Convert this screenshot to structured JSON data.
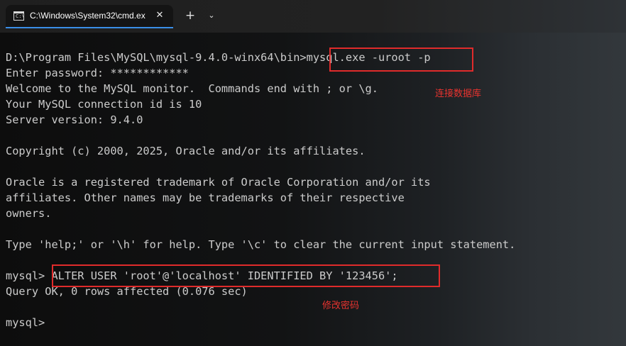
{
  "tab": {
    "icon": "cmd-icon",
    "title": "C:\\Windows\\System32\\cmd.ex",
    "close": "✕"
  },
  "titlebar": {
    "new_tab": "+",
    "dropdown": "⌄"
  },
  "terminal": {
    "lines": [
      "D:\\Program Files\\MySQL\\mysql-9.4.0-winx64\\bin>mysql.exe -uroot -p",
      "Enter password: ************",
      "Welcome to the MySQL monitor.  Commands end with ; or \\g.",
      "Your MySQL connection id is 10",
      "Server version: 9.4.0",
      "",
      "Copyright (c) 2000, 2025, Oracle and/or its affiliates.",
      "",
      "Oracle is a registered trademark of Oracle Corporation and/or its",
      "affiliates. Other names may be trademarks of their respective",
      "owners.",
      "",
      "Type 'help;' or '\\h' for help. Type '\\c' to clear the current input statement.",
      "",
      "mysql> ALTER USER 'root'@'localhost' IDENTIFIED BY '123456';",
      "Query OK, 0 rows affected (0.076 sec)",
      "",
      "mysql>"
    ]
  },
  "annotations": {
    "connect": "连接数据库",
    "change_password": "修改密码"
  },
  "colors": {
    "highlight": "#e02b2b",
    "annotation_text": "#e8332f",
    "terminal_text": "#cccccc",
    "tab_accent": "#3a8ee6"
  }
}
